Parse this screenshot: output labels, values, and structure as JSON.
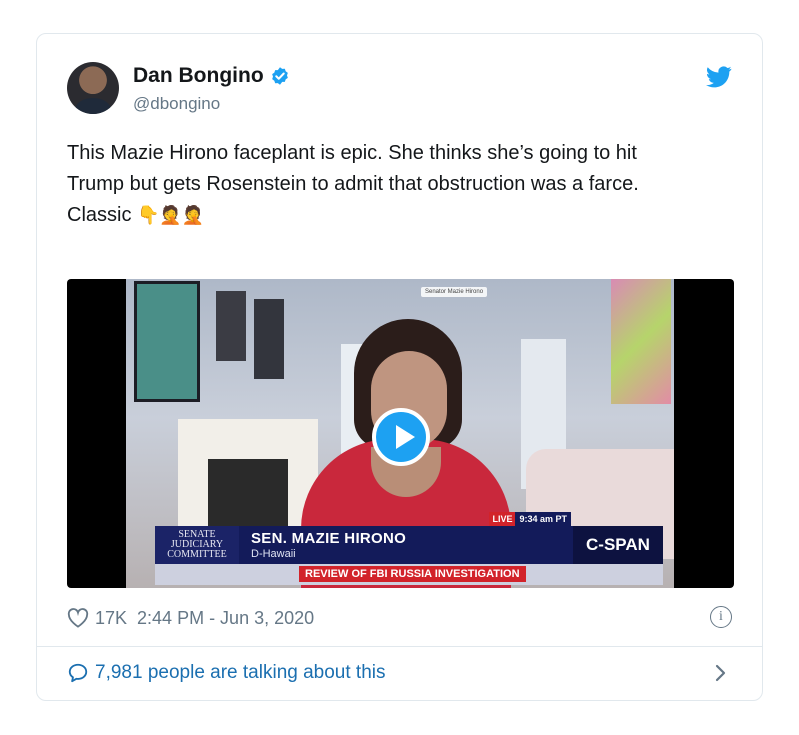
{
  "tweet": {
    "author": {
      "name": "Dan Bongino",
      "handle": "@dbongino",
      "verified": true
    },
    "text_line_1": "This Mazie Hirono faceplant is epic. She thinks she’s going to hit",
    "text_line_2": "Trump but gets Rosenstein to admit that obstruction was a farce.",
    "text_line_3": "Classic",
    "emojis": "👇🤦🤦",
    "video": {
      "zoom_tag": "Senator Mazie Hirono",
      "committee_line_1": "SENATE",
      "committee_line_2": "JUDICIARY",
      "committee_line_3": "COMMITTEE",
      "speaker_name": "SEN. MAZIE HIRONO",
      "speaker_state": "D-Hawaii",
      "live_label": "LIVE",
      "time": "9:34 am PT",
      "network": "C-SPAN",
      "headline": "REVIEW OF FBI RUSSIA INVESTIGATION"
    },
    "likes": "17K",
    "timestamp": "2:44 PM - Jun 3, 2020",
    "talking": "7,981 people are talking about this"
  },
  "colors": {
    "accent": "#1da1f2",
    "link": "#1b6fb0",
    "muted": "#657786",
    "border": "#e1e8ed"
  },
  "icons": [
    "verified-badge-icon",
    "twitter-bird-icon",
    "play-icon",
    "heart-icon",
    "info-icon",
    "speech-bubble-icon",
    "chevron-right-icon"
  ]
}
